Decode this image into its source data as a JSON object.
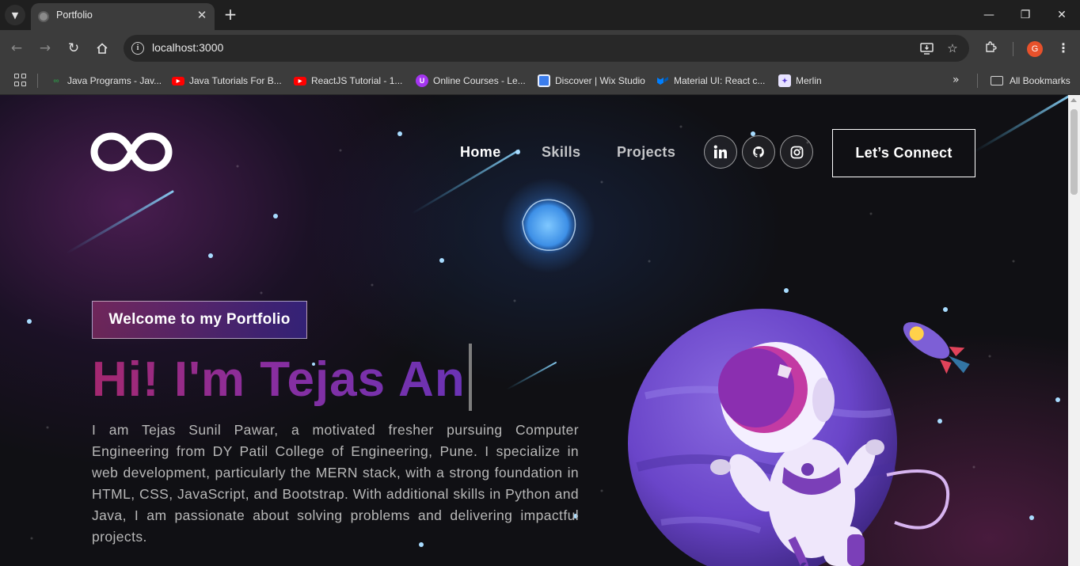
{
  "browser": {
    "tab_title": "Portfolio",
    "url": "localhost:3000",
    "profile_initial": "G",
    "bookmarks": [
      {
        "label": "Java Programs - Jav...",
        "icon": "geeksforgeeks-icon",
        "color": "#2f8d46"
      },
      {
        "label": "Java Tutorials For B...",
        "icon": "youtube-icon",
        "color": "#ff0000"
      },
      {
        "label": "ReactJS Tutorial - 1...",
        "icon": "youtube-icon",
        "color": "#ff0000"
      },
      {
        "label": "Online Courses - Le...",
        "icon": "udemy-icon",
        "color": "#a435f0"
      },
      {
        "label": "Discover | Wix Studio",
        "icon": "wix-icon",
        "color": "#3b7ded"
      },
      {
        "label": "Material UI: React c...",
        "icon": "mui-icon",
        "color": "#007fff"
      },
      {
        "label": "Merlin",
        "icon": "merlin-icon",
        "color": "#e7e3ff"
      }
    ],
    "all_bookmarks_label": "All Bookmarks"
  },
  "site": {
    "nav": {
      "home": "Home",
      "skills": "Skills",
      "projects": "Projects",
      "connect_label": "Let’s Connect",
      "socials": [
        "linkedin-icon",
        "github-icon",
        "instagram-icon"
      ]
    },
    "hero": {
      "tagline": "Welcome to my Portfolio",
      "title": "Hi! I'm Tejas An",
      "description": "I am Tejas Sunil Pawar, a motivated fresher pursuing Computer Engineering from DY Patil College of Engineering, Pune. I specialize in web development, particularly the MERN stack, with a strong foundation in HTML, CSS, JavaScript, and Bootstrap. With additional skills in Python and Java, I am passionate about solving problems and delivering impactful projects."
    },
    "colors": {
      "accent_pink": "#aa367c",
      "accent_purple": "#4a2fbd",
      "background": "#121212"
    }
  }
}
